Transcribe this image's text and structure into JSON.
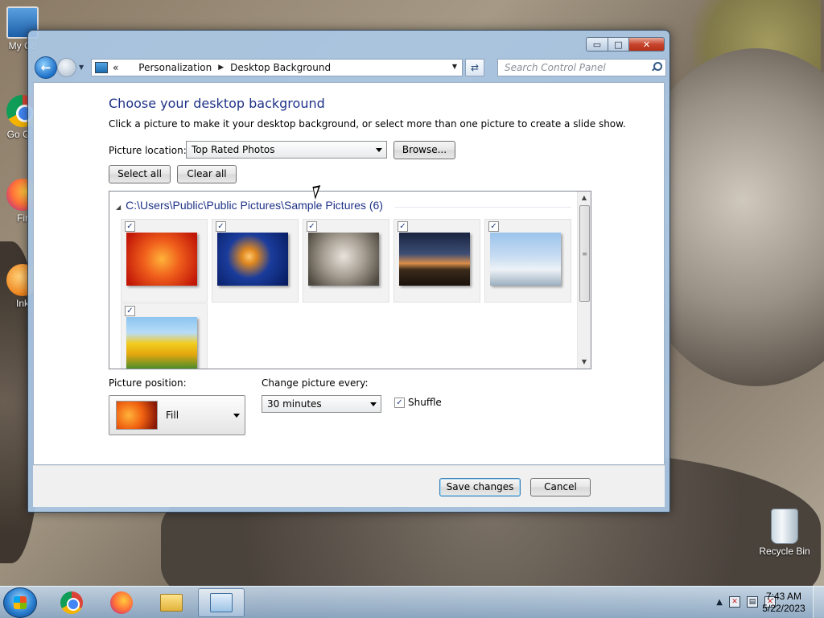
{
  "desktop": {
    "icons": [
      {
        "name": "My Co",
        "icon": "computer-icon"
      },
      {
        "name": "Go Chr",
        "icon": "chrome-icon"
      },
      {
        "name": "Fir",
        "icon": "firefox-icon"
      },
      {
        "name": "Ink",
        "icon": "inkscape-icon"
      }
    ],
    "recycle_bin": "Recycle Bin"
  },
  "window": {
    "controls": {
      "minimize": "▭",
      "maximize": "□",
      "close": "✕"
    },
    "breadcrumb": {
      "prefix": "«",
      "items": [
        "Personalization",
        "Desktop Background"
      ]
    },
    "search_placeholder": "Search Control Panel",
    "title": "Choose your desktop background",
    "description": "Click a picture to make it your desktop background, or select more than one picture to create a slide show.",
    "picture_location": {
      "label": "Picture location:",
      "value": "Top Rated Photos"
    },
    "browse_label": "Browse...",
    "select_all_label": "Select all",
    "clear_all_label": "Clear all",
    "gallery": {
      "group_title": "C:\\Users\\Public\\Public Pictures\\Sample Pictures (6)",
      "pictures": [
        {
          "name": "Chrysanthemum",
          "checked": true
        },
        {
          "name": "Jellyfish",
          "checked": true
        },
        {
          "name": "Koala",
          "checked": true
        },
        {
          "name": "Lighthouse",
          "checked": true
        },
        {
          "name": "Penguins",
          "checked": true
        },
        {
          "name": "Tulips",
          "checked": true
        }
      ]
    },
    "picture_position": {
      "label": "Picture position:",
      "value": "Fill"
    },
    "change_picture": {
      "label": "Change picture every:",
      "value": "30 minutes"
    },
    "shuffle": {
      "label": "Shuffle",
      "checked": true
    },
    "save_label": "Save changes",
    "cancel_label": "Cancel"
  },
  "taskbar": {
    "apps": [
      "chrome-icon",
      "firefox-icon",
      "explorer-icon",
      "control-panel-icon"
    ],
    "clock": {
      "time": "7:43 AM",
      "date": "5/22/2023"
    }
  }
}
